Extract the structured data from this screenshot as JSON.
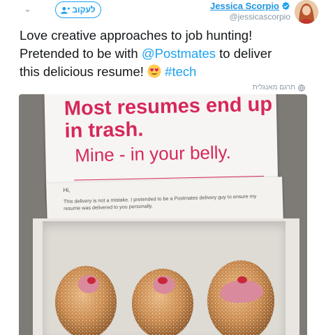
{
  "header": {
    "follow_label": "לעקוב",
    "user_name": "Jessica Scorpio",
    "user_handle": "@jessicascorpio"
  },
  "tweet": {
    "line1": "Love creative approaches to job hunting!",
    "line2_pre": "Pretended to be with ",
    "mention": "@Postmates",
    "line2_post": " to deliver",
    "line3_pre": "this delicious resume! ",
    "hashtag": "#tech",
    "translate_label": "תרגם מאנגלית"
  },
  "photo": {
    "headline": "Most resumes end up in trash.",
    "subhead": "Mine - in your belly.",
    "greeting": "Hi,",
    "note": "This delivery is not a mistake. I pretended to be a Postmates delivery guy to ensure my resume was delivered to you personally."
  },
  "colors": {
    "accent": "#1da1f2",
    "text": "#14171a",
    "muted": "#8899a6",
    "headline_pink": "#d6285a"
  }
}
